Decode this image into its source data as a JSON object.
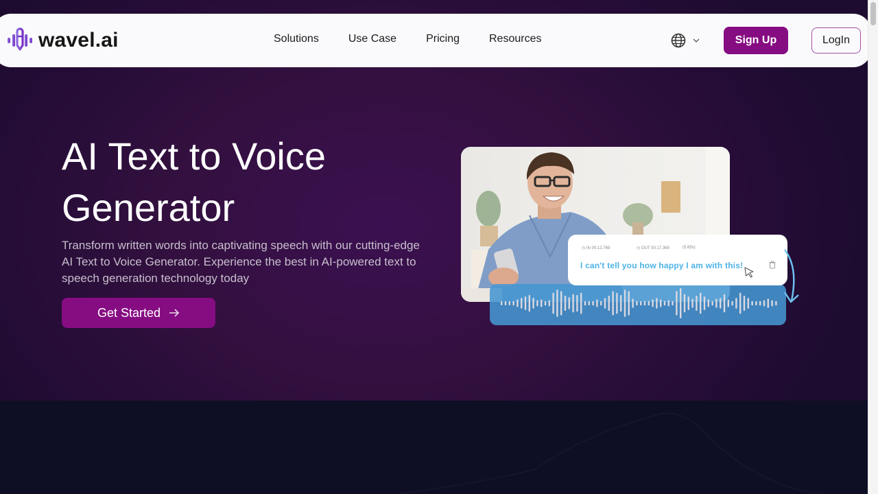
{
  "brand": {
    "name": "wavel.ai",
    "logo_icon": "soundwave-pen-icon",
    "accent_color": "#860c82",
    "logo_color": "#7b45d6"
  },
  "nav": {
    "links": [
      {
        "label": "Solutions"
      },
      {
        "label": "Use Case"
      },
      {
        "label": "Pricing"
      },
      {
        "label": "Resources"
      }
    ],
    "language_icon": "globe-icon",
    "language_chevron_icon": "chevron-down-icon",
    "signup_label": "Sign Up",
    "login_label": "LogIn"
  },
  "hero": {
    "title_line1": "AI Text to Voice",
    "title_line2": "Generator",
    "description": "Transform written words into captivating speech with our cutting-edge AI Text to Voice Generator. Experience the best in AI-powered text to speech generation technology today",
    "cta_label": "Get Started",
    "cta_icon": "arrow-right-icon"
  },
  "illustration": {
    "photo_alt": "smiling man with glasses holding a phone",
    "caption": {
      "in_time": "IN 00:12.769",
      "out_time": "OUT 00:17.369",
      "duration": "(5.65s)",
      "text": "I can't tell you how happy I am with this!"
    },
    "waveform_color": "#4696d2",
    "caption_color": "#4cb2e6"
  }
}
